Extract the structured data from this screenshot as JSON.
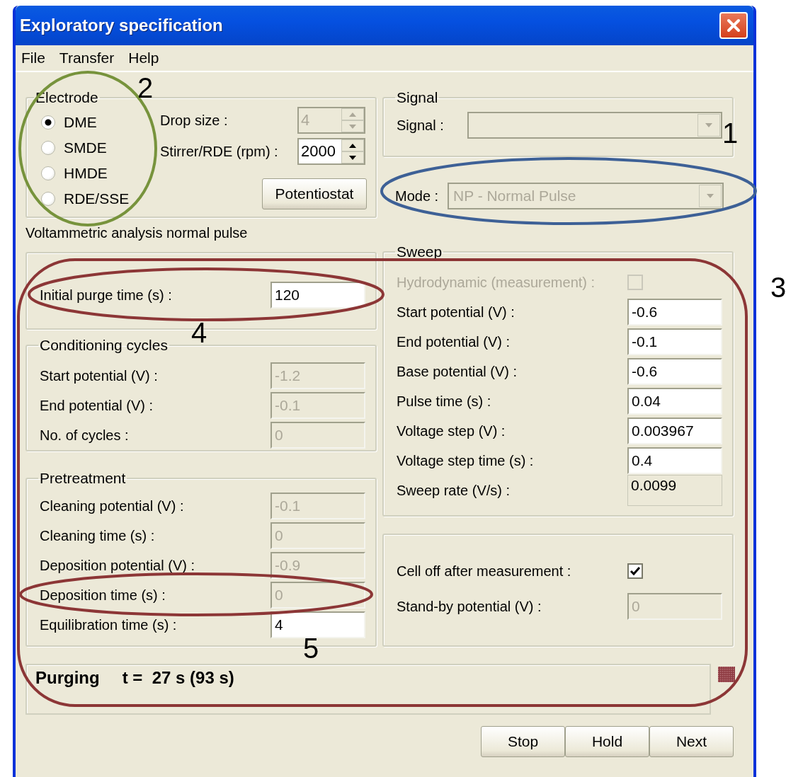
{
  "window": {
    "title": "Exploratory specification"
  },
  "menu": [
    "File",
    "Transfer",
    "Help"
  ],
  "electrode": {
    "title": "Electrode",
    "options": [
      {
        "label": "DME",
        "selected": true
      },
      {
        "label": "SMDE",
        "selected": false
      },
      {
        "label": "HMDE",
        "selected": false
      },
      {
        "label": "RDE/SSE",
        "selected": false
      }
    ],
    "spinners": [
      {
        "label": "Drop size :",
        "value": "4",
        "disabled": true
      },
      {
        "label": "Stirrer/RDE (rpm) :",
        "value": "2000",
        "disabled": false
      }
    ],
    "button": "Potentiostat"
  },
  "analysis_label": "Voltammetric analysis normal pulse",
  "purge": {
    "rows": [
      {
        "kind": "field",
        "label": "Initial purge time (s) :",
        "value": "120",
        "disabled": false
      }
    ]
  },
  "conditioning": {
    "title": "Conditioning cycles",
    "rows": [
      {
        "kind": "field",
        "label": "Start potential (V) :",
        "value": "-1.2",
        "disabled": true
      },
      {
        "kind": "field",
        "label": "End potential (V) :",
        "value": "-0.1",
        "disabled": true
      },
      {
        "kind": "field",
        "label": "No. of cycles :",
        "value": "0",
        "disabled": true
      }
    ]
  },
  "pretreatment": {
    "title": "Pretreatment",
    "rows": [
      {
        "kind": "field",
        "label": "Cleaning potential (V) :",
        "value": "-0.1",
        "disabled": true
      },
      {
        "kind": "field",
        "label": "Cleaning time (s) :",
        "value": "0",
        "disabled": true
      },
      {
        "kind": "field",
        "label": "Deposition potential (V) :",
        "value": "-0.9",
        "disabled": true
      },
      {
        "kind": "field",
        "label": "Deposition time (s) :",
        "value": "0",
        "disabled": true
      },
      {
        "kind": "field",
        "label": "Equilibration time (s) :",
        "value": "4",
        "disabled": false
      }
    ]
  },
  "signal": {
    "title": "Signal",
    "label": "Signal :",
    "disabled": true
  },
  "mode": {
    "label": "Mode :",
    "value": "NP - Normal Pulse",
    "disabled": true
  },
  "sweep": {
    "title": "Sweep",
    "rows": [
      {
        "kind": "checkbox",
        "label": "Hydrodynamic (measurement) :",
        "checked": false,
        "disabled": true
      },
      {
        "kind": "field",
        "label": "Start potential (V) :",
        "value": "-0.6",
        "disabled": false
      },
      {
        "kind": "field",
        "label": "End potential (V) :",
        "value": "-0.1",
        "disabled": false
      },
      {
        "kind": "field",
        "label": "Base potential (V) :",
        "value": "-0.6",
        "disabled": false
      },
      {
        "kind": "field",
        "label": "Pulse time (s) :",
        "value": "0.04",
        "disabled": false
      },
      {
        "kind": "field",
        "label": "Voltage step (V) :",
        "value": "0.003967",
        "disabled": false
      },
      {
        "kind": "field",
        "label": "Voltage step time (s) :",
        "value": "0.4",
        "disabled": false
      },
      {
        "kind": "readout",
        "label": "Sweep rate (V/s) :",
        "value": "0.0099",
        "disabled": false
      }
    ]
  },
  "cell": {
    "rows": [
      {
        "kind": "checkbox",
        "label": "Cell off after measurement :",
        "checked": true,
        "disabled": false
      },
      {
        "kind": "field",
        "label": "Stand-by potential (V) :",
        "value": "0",
        "disabled": true
      }
    ]
  },
  "status": {
    "state": "Purging",
    "time": "t =  27 s (93 s)"
  },
  "buttons": [
    "Stop",
    "Hold",
    "Next"
  ],
  "annotations": [
    {
      "number": "1",
      "kind": "ellipse",
      "color": "#3d6096"
    },
    {
      "number": "2",
      "kind": "ellipse",
      "color": "#77933c"
    },
    {
      "number": "3",
      "kind": "frame",
      "color": "#8c3636"
    },
    {
      "number": "4",
      "kind": "ellipse",
      "color": "#8c3636"
    },
    {
      "number": "5",
      "kind": "ellipse",
      "color": "#8c3636"
    }
  ]
}
